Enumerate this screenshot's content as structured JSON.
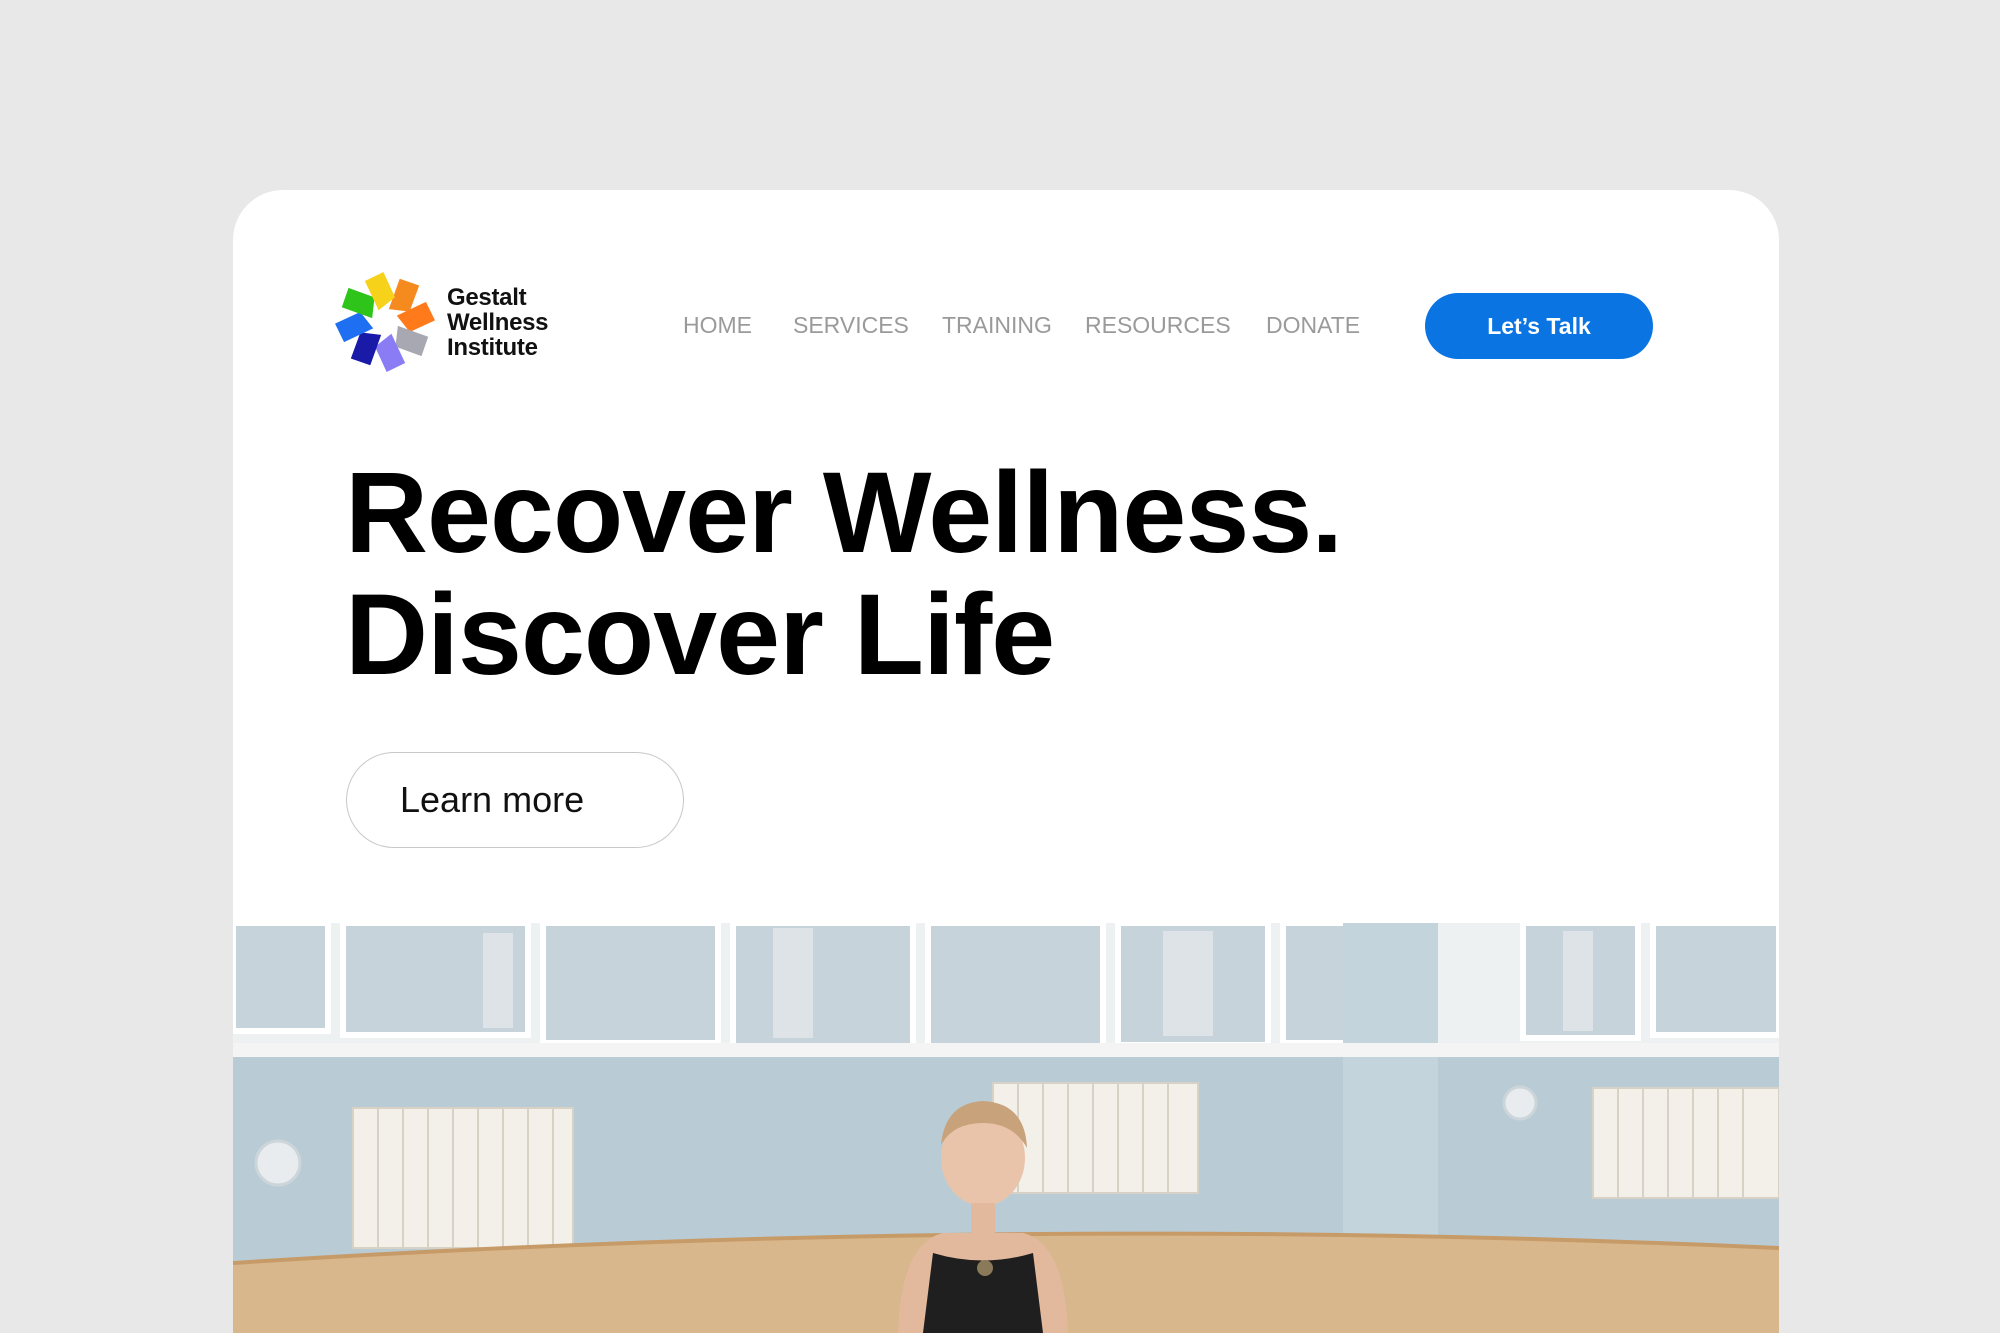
{
  "brand": {
    "line1": "Gestalt",
    "line2": "Wellness",
    "line3": "Institute"
  },
  "nav": {
    "items": [
      {
        "label": "HOME"
      },
      {
        "label": "SERVICES"
      },
      {
        "label": "TRAINING"
      },
      {
        "label": "RESOURCES"
      },
      {
        "label": "DONATE"
      }
    ],
    "cta_label": "Let’s Talk"
  },
  "hero": {
    "title_line1": "Recover Wellness.",
    "title_line2": "Discover Life",
    "button_label": "Learn more"
  },
  "colors": {
    "background": "#e8e8e8",
    "card": "#ffffff",
    "accent": "#0a74e3",
    "nav_text": "#9a9a9a"
  },
  "icons": {
    "logo": "pinwheel-logo-icon"
  }
}
